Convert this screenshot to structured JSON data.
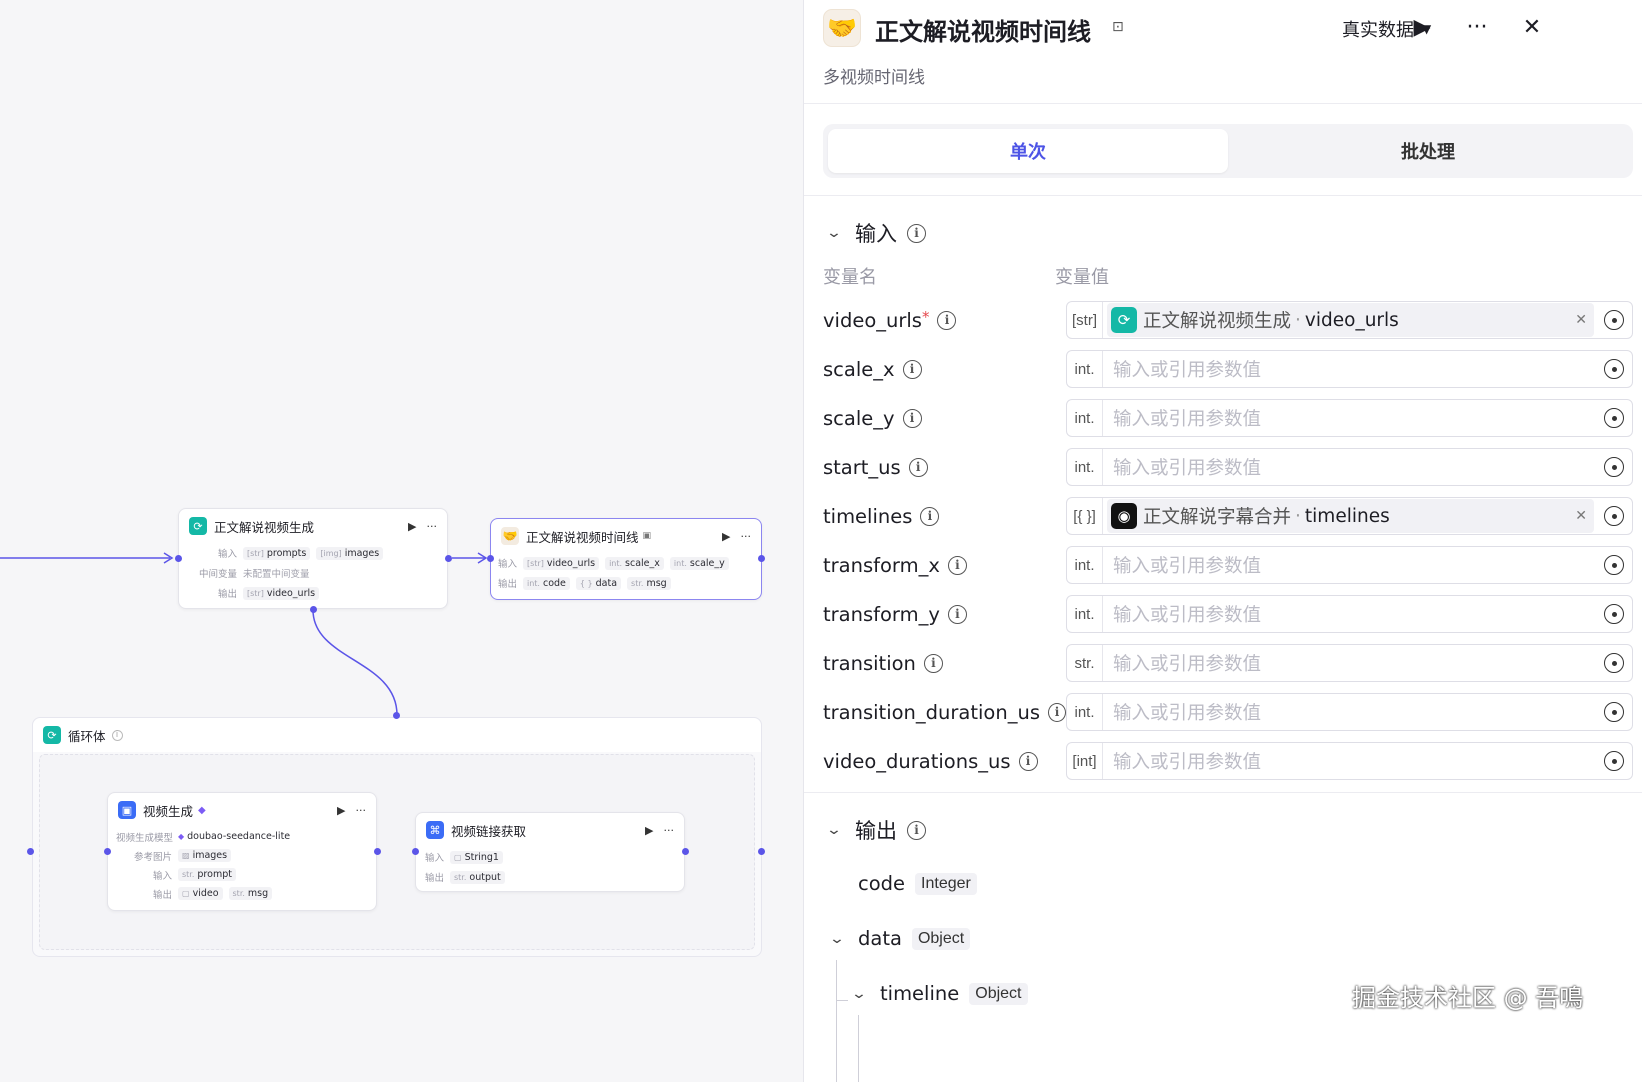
{
  "canvas": {
    "node_main": {
      "title": "正文解说视频生成",
      "rows": [
        {
          "label": "输入",
          "chips": [
            {
              "type": "[str]",
              "text": "prompts"
            },
            {
              "type": "[img]",
              "text": "images"
            }
          ]
        },
        {
          "label": "中间变量",
          "text": "未配置中间变量"
        },
        {
          "label": "输出",
          "chips": [
            {
              "type": "[str]",
              "text": "video_urls"
            }
          ]
        }
      ]
    },
    "node_timeline": {
      "title": "正文解说视频时间线",
      "rows": [
        {
          "label": "输入",
          "chips": [
            {
              "type": "[str]",
              "text": "video_urls"
            },
            {
              "type": "int.",
              "text": "scale_x"
            },
            {
              "type": "int.",
              "text": "scale_y"
            }
          ]
        },
        {
          "label": "输出",
          "chips": [
            {
              "type": "int.",
              "text": "code"
            },
            {
              "type": "{ }",
              "text": "data"
            },
            {
              "type": "str.",
              "text": "msg"
            }
          ]
        }
      ]
    },
    "loop": {
      "title": "循环体"
    },
    "node_video": {
      "title": "视频生成",
      "rows": [
        {
          "label": "视频生成模型",
          "chips": [
            {
              "type": "◆",
              "text": "doubao-seedance-lite"
            }
          ]
        },
        {
          "label": "参考图片",
          "chips": [
            {
              "type": "▨",
              "text": "images"
            }
          ]
        },
        {
          "label": "输入",
          "chips": [
            {
              "type": "str.",
              "text": "prompt"
            }
          ]
        },
        {
          "label": "输出",
          "chips": [
            {
              "type": "▢",
              "text": "video"
            },
            {
              "type": "str.",
              "text": "msg"
            }
          ]
        }
      ]
    },
    "node_link": {
      "title": "视频链接获取",
      "rows": [
        {
          "label": "输入",
          "chips": [
            {
              "type": "▢",
              "text": "String1"
            }
          ]
        },
        {
          "label": "输出",
          "chips": [
            {
              "type": "str.",
              "text": "output"
            }
          ]
        }
      ]
    }
  },
  "panel": {
    "title": "正文解说视频时间线",
    "description": "多视频时间线",
    "data_source": "真实数据",
    "tabs": [
      "单次",
      "批处理"
    ],
    "input_section": "输入",
    "col_name": "变量名",
    "col_value": "变量值",
    "placeholder": "输入或引用参数值",
    "params": [
      {
        "name": "video_urls",
        "required": true,
        "type": "[str]",
        "ref_node": "正文解说视频生成",
        "ref_var": "video_urls",
        "ref_color": "#14b8a6"
      },
      {
        "name": "scale_x",
        "type": "int."
      },
      {
        "name": "scale_y",
        "type": "int."
      },
      {
        "name": "start_us",
        "type": "int."
      },
      {
        "name": "timelines",
        "type": "[{ }]",
        "ref_node": "正文解说字幕合并",
        "ref_var": "timelines",
        "ref_color": "#111111"
      },
      {
        "name": "transform_x",
        "type": "int."
      },
      {
        "name": "transform_y",
        "type": "int."
      },
      {
        "name": "transition",
        "type": "str."
      },
      {
        "name": "transition_duration_us",
        "type": "int."
      },
      {
        "name": "video_durations_us",
        "type": "[int]"
      }
    ],
    "output_section": "输出",
    "outputs": [
      {
        "name": "code",
        "type": "Integer"
      },
      {
        "name": "data",
        "type": "Object"
      },
      {
        "name": "timeline",
        "type": "Object"
      }
    ],
    "watermark": "掘金技术社区 @ 吾鳴"
  },
  "colors": {
    "accent": "#4d54e6",
    "wire": "#5b55e8",
    "teal": "#14b8a6",
    "blue": "#3b6cf6"
  }
}
